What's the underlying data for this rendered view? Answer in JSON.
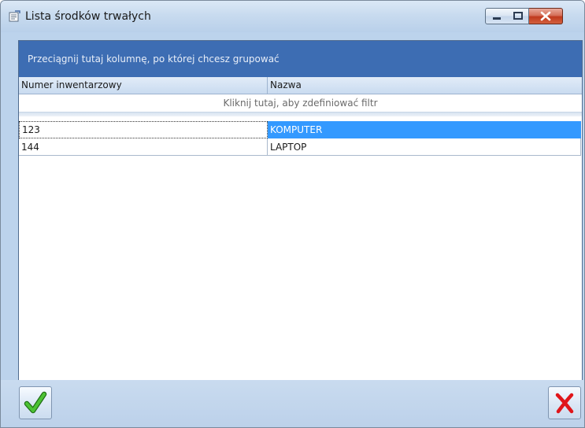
{
  "window": {
    "title": "Lista środków trwałych",
    "icon": "list-window-icon",
    "controls": [
      "minimize-icon",
      "maximize-icon",
      "close-icon"
    ]
  },
  "grid": {
    "group_panel_text": "Przeciągnij tutaj kolumnę, po której chcesz grupować",
    "columns": [
      "Numer inwentarzowy",
      "Nazwa"
    ],
    "filter_text": "Kliknij tutaj, aby zdefiniować filtr",
    "rows": [
      {
        "numer": "123",
        "nazwa": "KOMPUTER",
        "selected": true
      },
      {
        "numer": "144",
        "nazwa": "LAPTOP",
        "selected": false
      }
    ]
  },
  "footer": {
    "ok_icon": "checkmark-icon",
    "cancel_icon": "red-x-icon"
  },
  "colors": {
    "group_panel": "#3d6db3",
    "selection": "#3399ff",
    "ok_green": "#2e9e1f",
    "cancel_red": "#e0161a"
  }
}
